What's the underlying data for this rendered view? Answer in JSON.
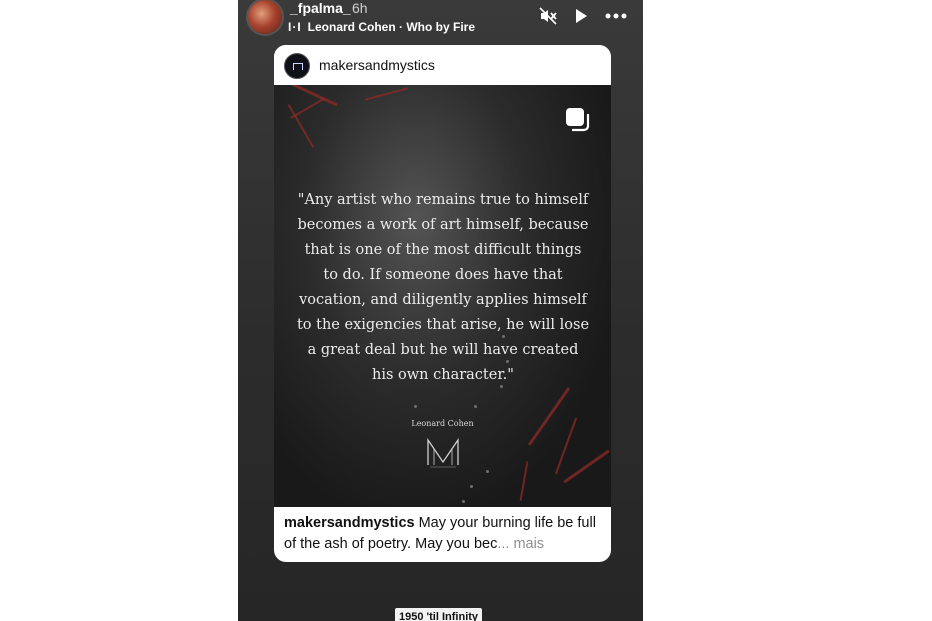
{
  "header": {
    "username": "_fpalma_",
    "time": "6h",
    "music": "Leonard Cohen · Who by Fire",
    "icons": [
      "avatar",
      "music-bars-icon",
      "mute-icon",
      "play-icon",
      "more-icon"
    ]
  },
  "post": {
    "account": "makersandmystics",
    "quote": "\"Any artist who remains true to himself becomes a work of art himself, because that is one of the most difficult things to do. If someone does have that vocation, and diligently applies himself to the exigencies that arise, he will lose a great deal but he will have created his own character.\"",
    "author": "Leonard Cohen",
    "caption_user": "makersandmystics",
    "caption_text": " May your burning life be full of the ash of poetry. May you bec",
    "caption_more": "... mais"
  },
  "sticker": "1950 'til Infinity",
  "colors": {
    "story_bg": "#2f2f2f",
    "card_bg": "#ffffff",
    "accent_red": "#8c2a26"
  }
}
